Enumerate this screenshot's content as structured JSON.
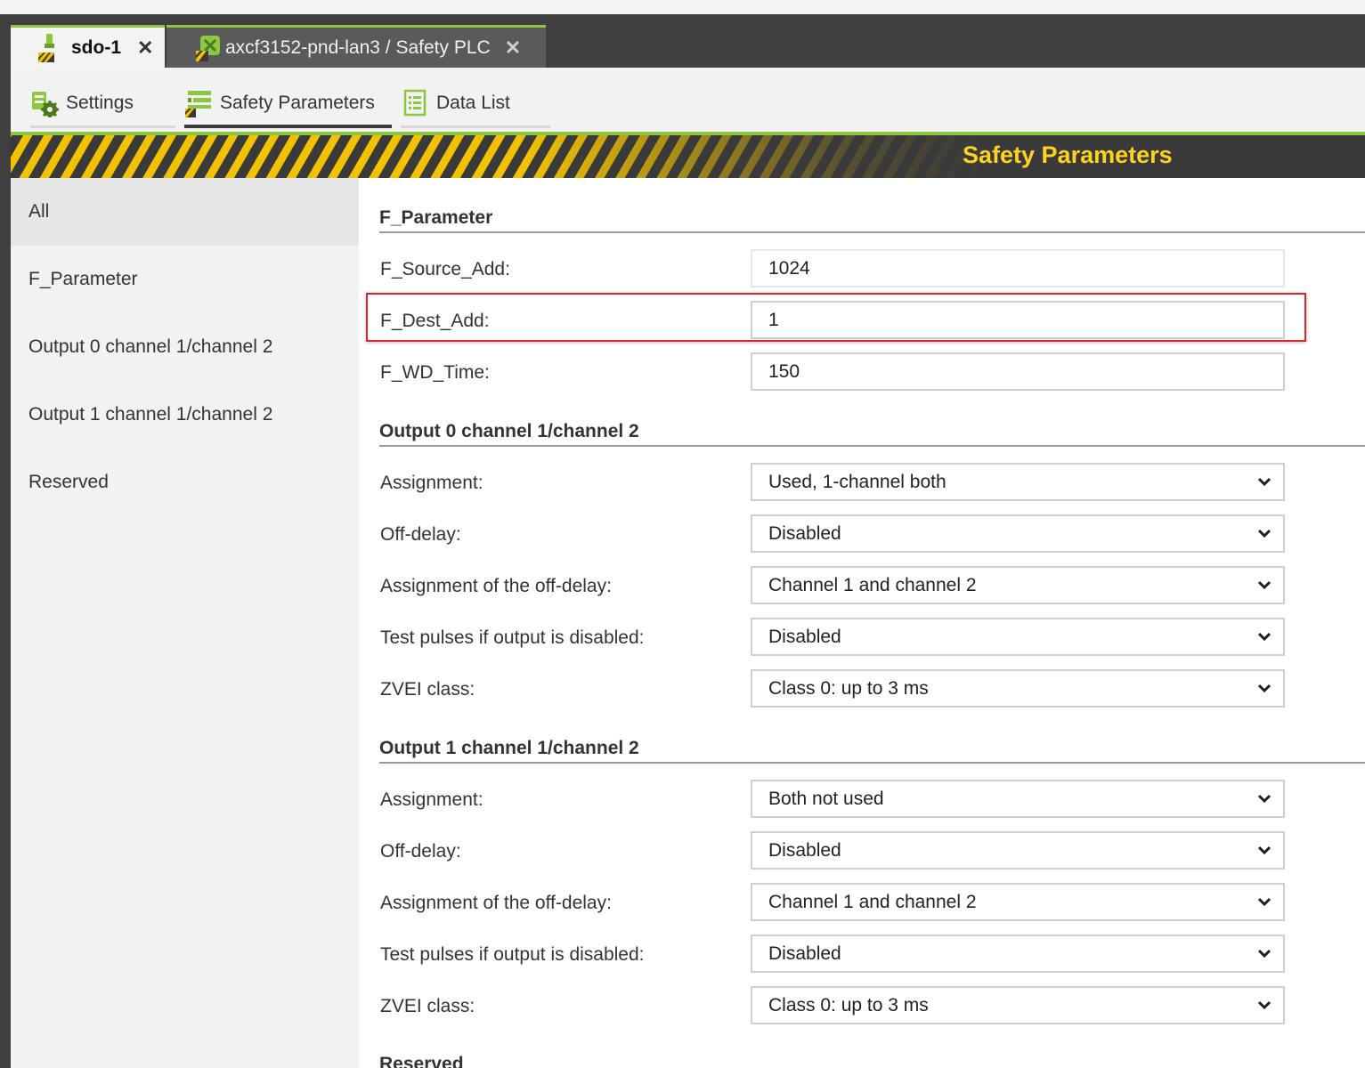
{
  "colors": {
    "accent_green": "#8dc63f",
    "hazard_yellow": "#f2c200",
    "title_yellow": "#ffd21f",
    "dark_frame": "#3f3f3f",
    "highlight_red": "#e0252a"
  },
  "doc_tabs": [
    {
      "label": "sdo-1",
      "icon": "safety-device-icon",
      "close": "✕"
    },
    {
      "label": "axcf3152-pnd-lan3 / Safety PLC",
      "icon": "safety-plc-icon",
      "close": "✕"
    }
  ],
  "sub_tabs": [
    {
      "label": "Settings",
      "icon": "settings-gear-icon"
    },
    {
      "label": "Safety Parameters",
      "icon": "safety-parameters-icon",
      "selected": true
    },
    {
      "label": "Data List",
      "icon": "data-list-icon"
    }
  ],
  "banner": {
    "title": "Safety Parameters"
  },
  "nav": {
    "items": [
      {
        "label": "All",
        "selected": true
      },
      {
        "label": "F_Parameter"
      },
      {
        "label": "Output 0 channel 1/channel 2"
      },
      {
        "label": "Output 1 channel 1/channel 2"
      },
      {
        "label": "Reserved"
      }
    ]
  },
  "sections": {
    "f_parameter": {
      "title": "F_Parameter",
      "fields": [
        {
          "label": "F_Source_Add:",
          "value": "1024"
        },
        {
          "label": "F_Dest_Add:",
          "value": "1"
        },
        {
          "label": "F_WD_Time:",
          "value": "150"
        }
      ]
    },
    "output0": {
      "title": "Output 0 channel 1/channel 2",
      "fields": [
        {
          "label": "Assignment:",
          "value": "Used, 1-channel both"
        },
        {
          "label": "Off-delay:",
          "value": "Disabled"
        },
        {
          "label": "Assignment of the off-delay:",
          "value": "Channel 1 and channel 2"
        },
        {
          "label": "Test pulses if output is disabled:",
          "value": "Disabled"
        },
        {
          "label": "ZVEI class:",
          "value": "Class 0: up to 3 ms"
        }
      ]
    },
    "output1": {
      "title": "Output 1 channel 1/channel 2",
      "fields": [
        {
          "label": "Assignment:",
          "value": "Both not used"
        },
        {
          "label": "Off-delay:",
          "value": "Disabled"
        },
        {
          "label": "Assignment of the off-delay:",
          "value": "Channel 1 and channel 2"
        },
        {
          "label": "Test pulses if output is disabled:",
          "value": "Disabled"
        },
        {
          "label": "ZVEI class:",
          "value": "Class 0: up to 3 ms"
        }
      ]
    },
    "reserved": {
      "title": "Reserved"
    }
  }
}
